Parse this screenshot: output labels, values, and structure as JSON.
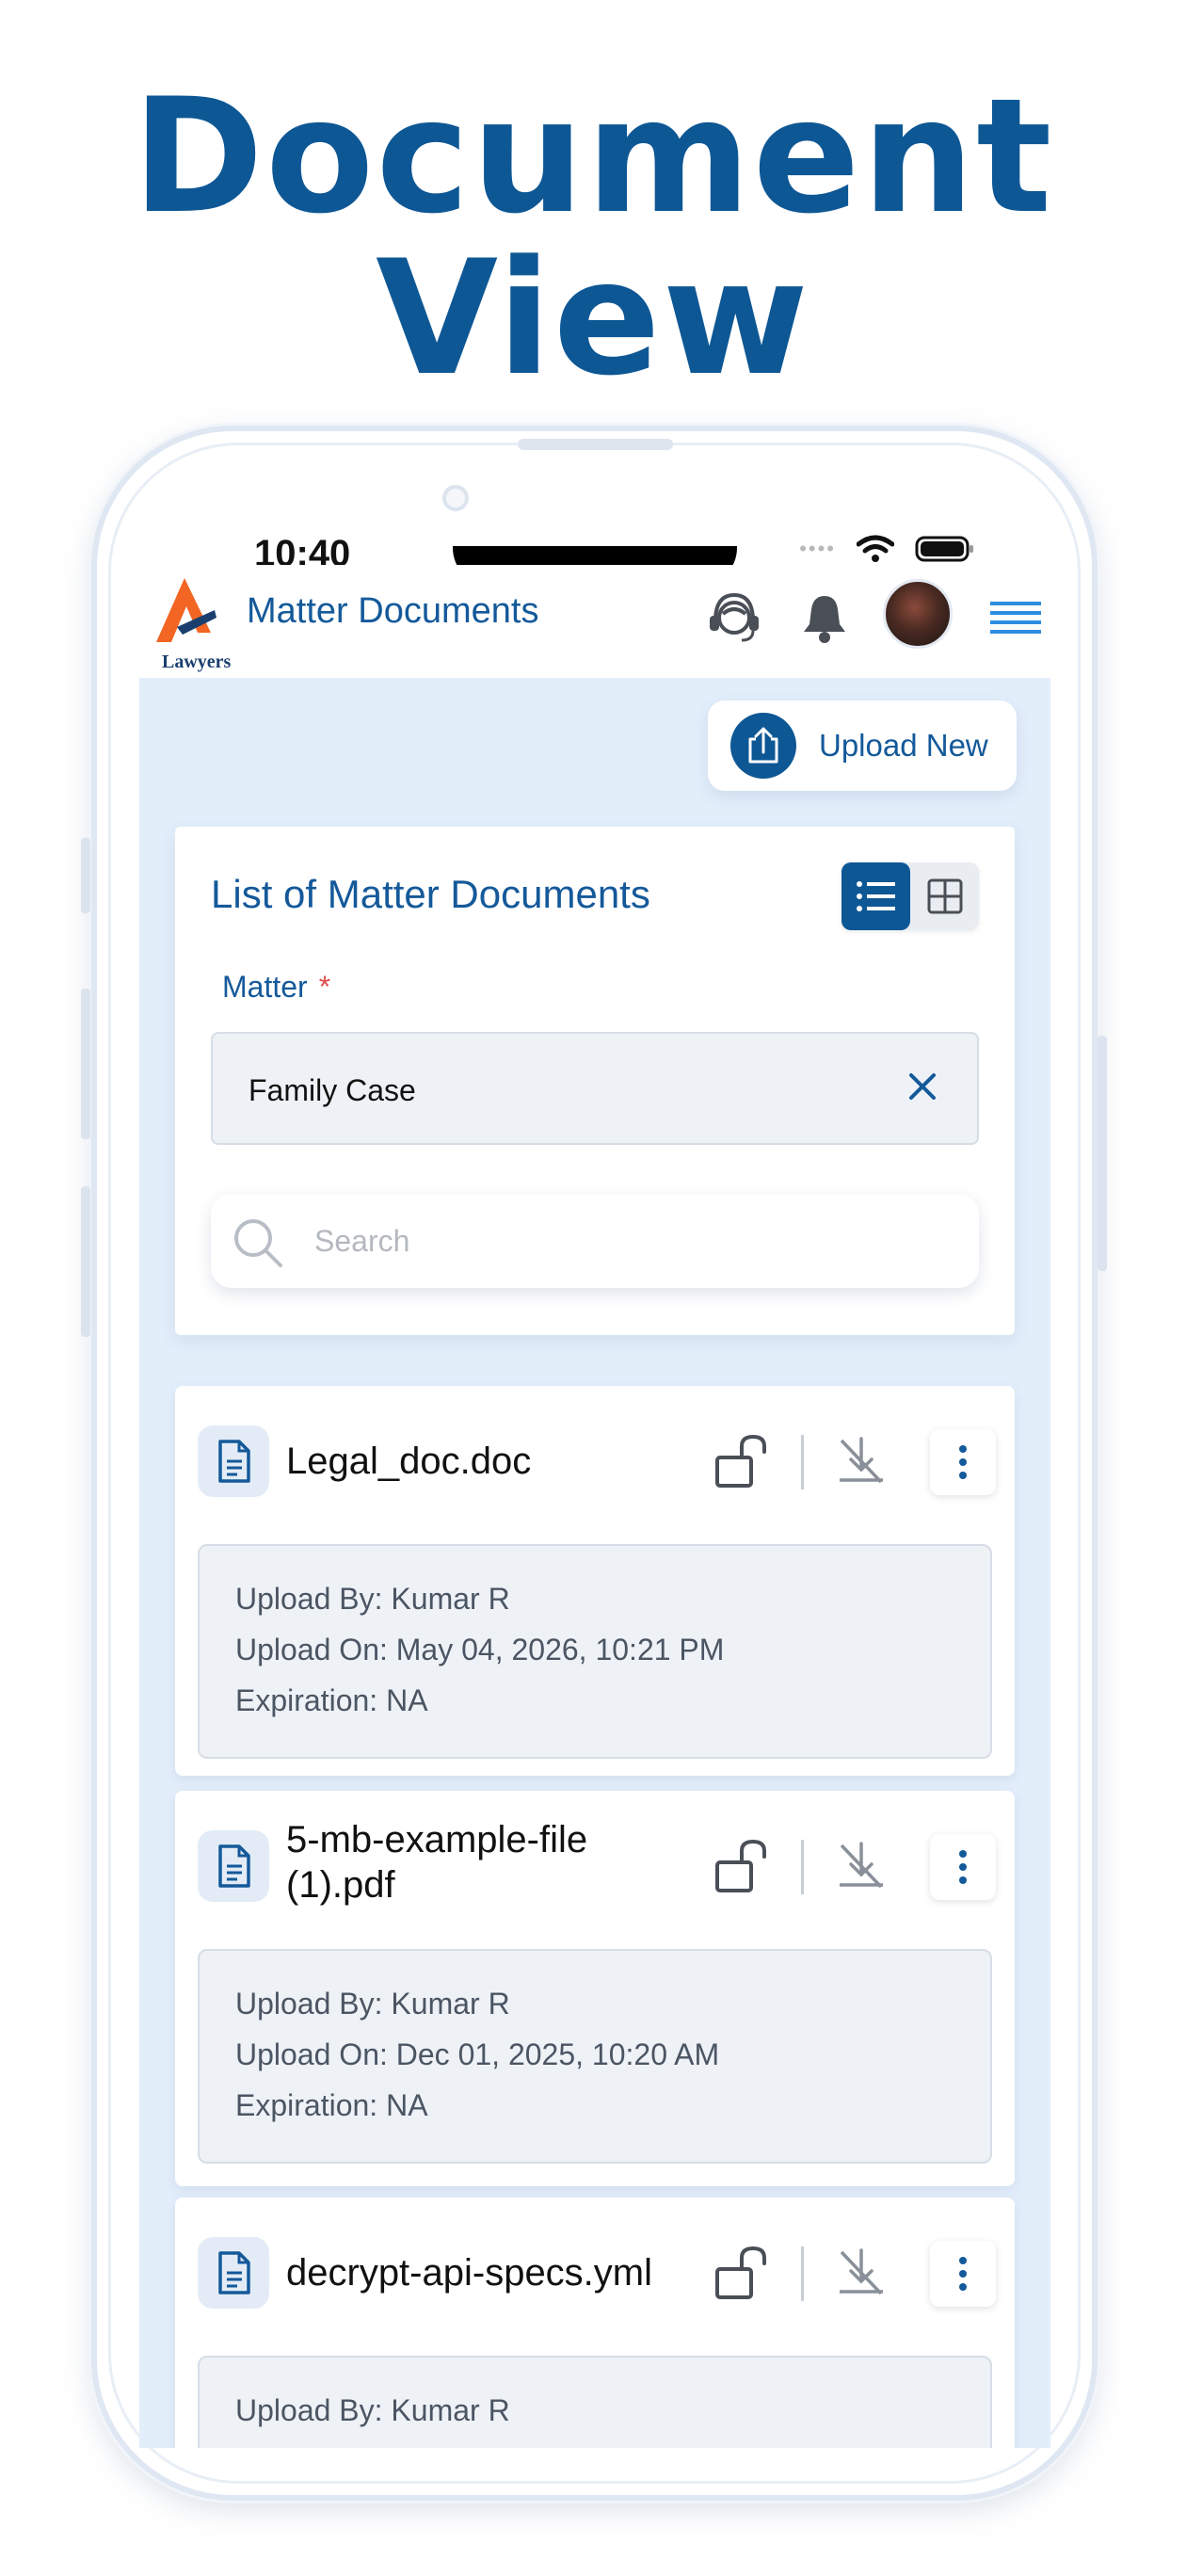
{
  "promo": {
    "title_line1": "Document",
    "title_line2": "View"
  },
  "status_bar": {
    "time": "10:40"
  },
  "header": {
    "logo_text": "Lawyers",
    "title": "Matter Documents"
  },
  "upload": {
    "label": "Upload New"
  },
  "list_card": {
    "title": "List of Matter Documents",
    "matter_label": "Matter",
    "required_mark": "*",
    "matter_value": "Family Case",
    "search_placeholder": "Search"
  },
  "documents": [
    {
      "name": "Legal_doc.doc",
      "upload_by": "Upload By:  Kumar R",
      "upload_on": "Upload On: May 04, 2026, 10:21 PM",
      "expiration": "Expiration: NA"
    },
    {
      "name": "5-mb-example-file (1).pdf",
      "upload_by": "Upload By:  Kumar R",
      "upload_on": "Upload On: Dec 01, 2025, 10:20 AM",
      "expiration": "Expiration: NA"
    },
    {
      "name": "decrypt-api-specs.yml",
      "upload_by": "Upload By:  Kumar R",
      "upload_on": "",
      "expiration": ""
    }
  ],
  "colors": {
    "brand": "#0e5795",
    "background": "#e3eefb",
    "accent_orange": "#f26522"
  }
}
